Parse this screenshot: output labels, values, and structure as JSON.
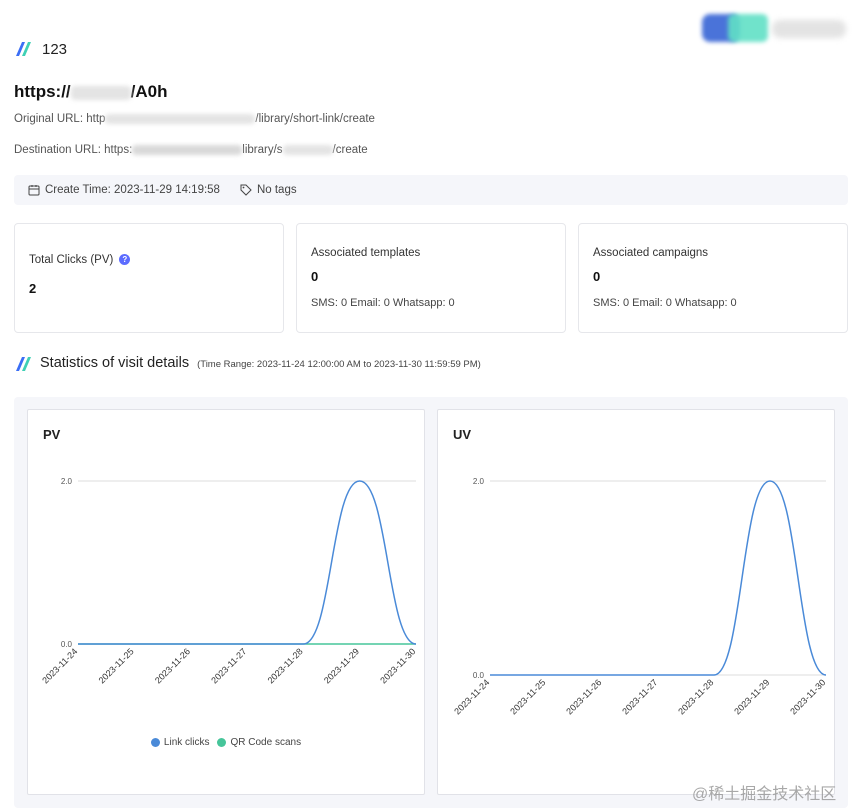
{
  "header": {
    "title": "123",
    "short_url_prefix": "https://",
    "short_url_suffix": "/A0h"
  },
  "meta": {
    "original_label": "Original URL:",
    "original_prefix": "http",
    "original_suffix": "/library/short-link/create",
    "destination_label": "Destination URL:",
    "destination_prefix": "https:",
    "destination_mid": "library/s",
    "destination_suffix": "/create"
  },
  "info": {
    "create_time": "Create Time: 2023-11-29 14:19:58",
    "tags": "No tags"
  },
  "cards": {
    "total_clicks": {
      "label": "Total Clicks (PV)",
      "help": "?",
      "value": "2"
    },
    "templates": {
      "label": "Associated templates",
      "value": "0",
      "sub": "SMS: 0 Email: 0 Whatsapp: 0"
    },
    "campaigns": {
      "label": "Associated campaigns",
      "value": "0",
      "sub": "SMS: 0 Email: 0 Whatsapp: 0"
    }
  },
  "stats": {
    "title": "Statistics of visit details",
    "range": "(Time Range: 2023-11-24 12:00:00 AM to 2023-11-30 11:59:59 PM)"
  },
  "colors": {
    "line_blue": "#4a8ad8",
    "line_green": "#46c59a",
    "icon_blue": "#3b6ef5",
    "icon_teal": "#3fd0b5"
  },
  "chart_data": [
    {
      "type": "line",
      "title": "PV",
      "categories": [
        "2023-11-24",
        "2023-11-25",
        "2023-11-26",
        "2023-11-27",
        "2023-11-28",
        "2023-11-29",
        "2023-11-30"
      ],
      "series": [
        {
          "name": "Link clicks",
          "values": [
            0,
            0,
            0,
            0,
            0,
            2,
            0
          ]
        },
        {
          "name": "QR Code scans",
          "values": [
            0,
            0,
            0,
            0,
            0,
            0,
            0
          ]
        }
      ],
      "y_ticks": [
        "2.0",
        "0.0"
      ],
      "ylim": [
        0,
        2
      ],
      "legend": "bottom"
    },
    {
      "type": "line",
      "title": "UV",
      "categories": [
        "2023-11-24",
        "2023-11-25",
        "2023-11-26",
        "2023-11-27",
        "2023-11-28",
        "2023-11-29",
        "2023-11-30"
      ],
      "series": [
        {
          "values": [
            0,
            0,
            0,
            0,
            0,
            2,
            0
          ]
        }
      ],
      "y_ticks": [
        "2.0",
        "0.0"
      ],
      "ylim": [
        0,
        2
      ]
    }
  ],
  "watermark": "@稀土掘金技术社区"
}
